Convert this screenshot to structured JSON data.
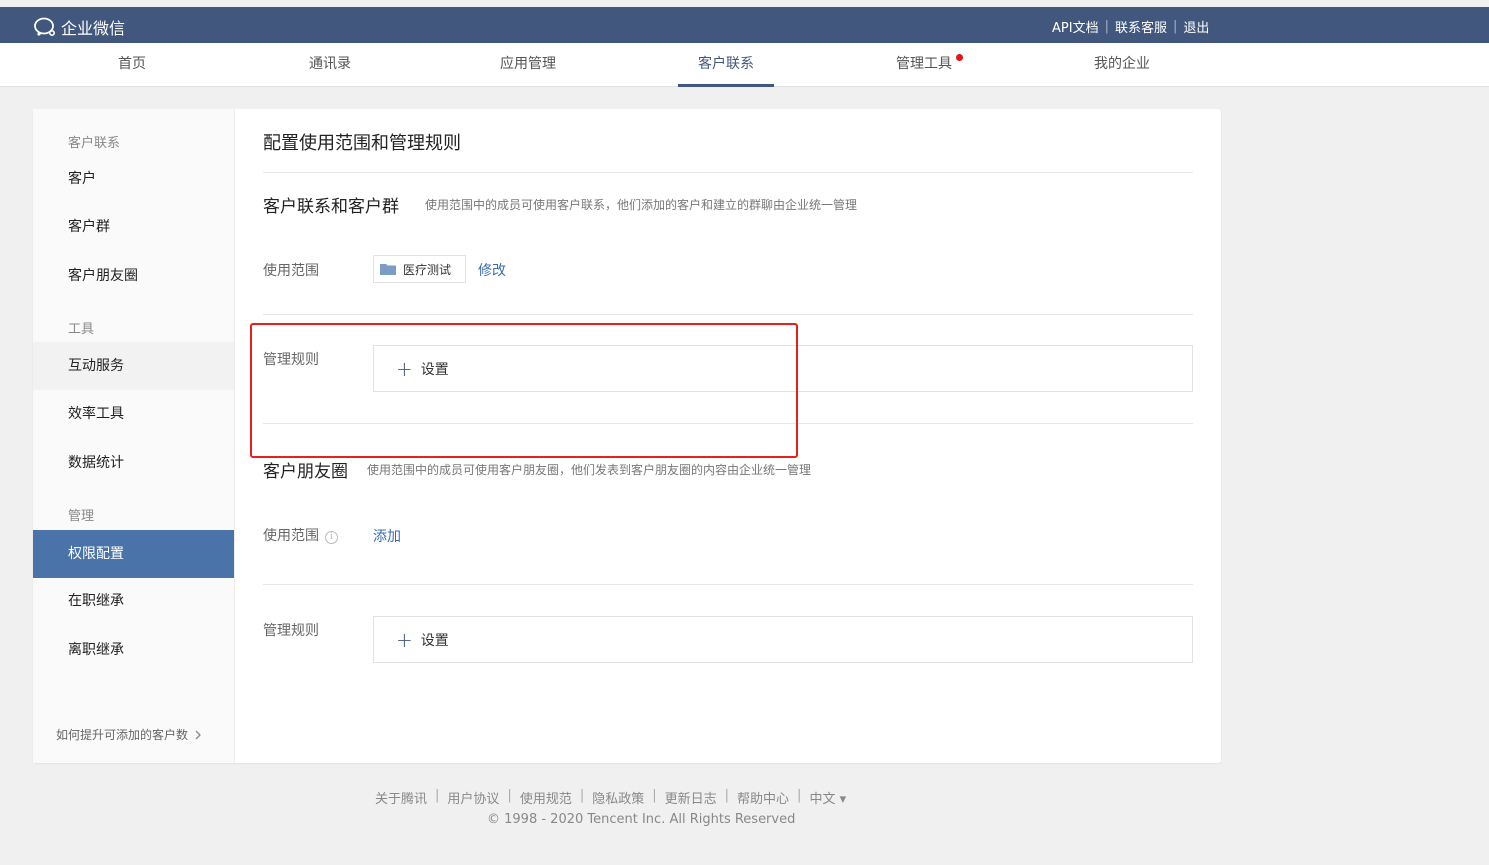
{
  "header": {
    "logo_text": "企业微信",
    "links": [
      "API文档",
      "联系客服",
      "退出"
    ]
  },
  "nav": {
    "items": [
      "首页",
      "通讯录",
      "应用管理",
      "客户联系",
      "管理工具",
      "我的企业"
    ],
    "active": "客户联系"
  },
  "sidebar": {
    "groups": [
      "客户联系",
      "工具",
      "管理"
    ],
    "items": [
      "客户",
      "客户群",
      "客户朋友圈",
      "互动服务",
      "效率工具",
      "数据统计",
      "权限配置",
      "在职继承",
      "离职继承"
    ],
    "active": "权限配置",
    "tip": "如何提升可添加的客户数"
  },
  "main": {
    "page_title": "配置使用范围和管理规则",
    "section1": {
      "title": "客户联系和客户群",
      "desc": "使用范围中的成员可使用客户联系，他们添加的客户和建立的群聊由企业统一管理",
      "scope_label": "使用范围",
      "dept_tag": "医疗测试",
      "modify_link": "修改",
      "rules_label": "管理规则",
      "set_button": "设置"
    },
    "section2": {
      "title": "客户朋友圈",
      "desc": "使用范围中的成员可使用客户朋友圈，他们发表到客户朋友圈的内容由企业统一管理",
      "scope_label": "使用范围",
      "info_glyph": "i",
      "add_link": "添加",
      "rules_label": "管理规则",
      "set_button": "设置"
    }
  },
  "footer": {
    "links": [
      "关于腾讯",
      "用户协议",
      "使用规范",
      "隐私政策",
      "更新日志",
      "帮助中心",
      "中文 ▾"
    ],
    "copyright": "© 1998 - 2020 Tencent Inc. All Rights Reserved"
  },
  "colors": {
    "topbar": "#42577d",
    "active_sidebar": "#4a73aa",
    "link": "#3b6cb0",
    "highlight": "#e8201c",
    "badge": "#e8101a"
  }
}
